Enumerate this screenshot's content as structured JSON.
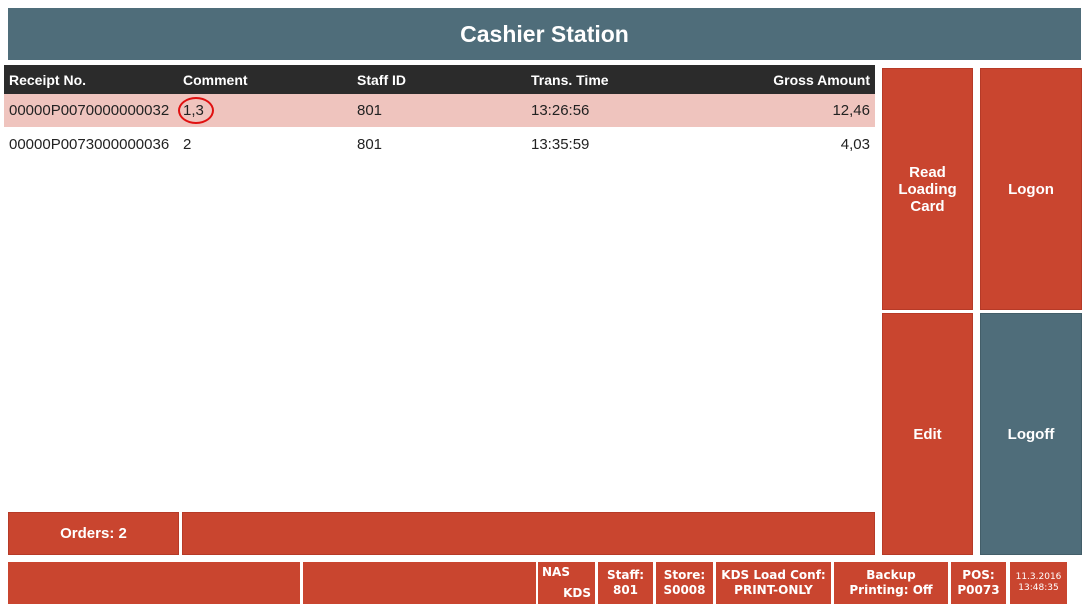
{
  "title": "Cashier Station",
  "table": {
    "columns": [
      "Receipt No.",
      "Comment",
      "Staff ID",
      "Trans. Time",
      "Gross Amount"
    ],
    "rows": [
      {
        "receipt": "00000P0070000000032",
        "comment": "1,3",
        "staff": "801",
        "time": "13:26:56",
        "amount": "12,46"
      },
      {
        "receipt": "00000P0073000000036",
        "comment": "2",
        "staff": "801",
        "time": "13:35:59",
        "amount": "4,03"
      }
    ]
  },
  "buttons": {
    "read_card": "Read Loading Card",
    "logon": "Logon",
    "edit": "Edit",
    "logoff": "Logoff",
    "orders": "Orders: 2"
  },
  "status": {
    "nas": "NAS",
    "kds": "KDS",
    "staff_label": "Staff:",
    "staff": "801",
    "store_label": "Store:",
    "store": "S0008",
    "kds_label": "KDS Load Conf:",
    "kds_value": "PRINT-ONLY",
    "backup_label": "Backup",
    "backup_value": "Printing: Off",
    "pos_label": "POS:",
    "pos": "P0073",
    "date": "11.3.2016",
    "time": "13:48:35"
  },
  "colors": {
    "header": "#4f6d7a",
    "accent": "#c9452f",
    "selected_row": "#efc4be"
  }
}
